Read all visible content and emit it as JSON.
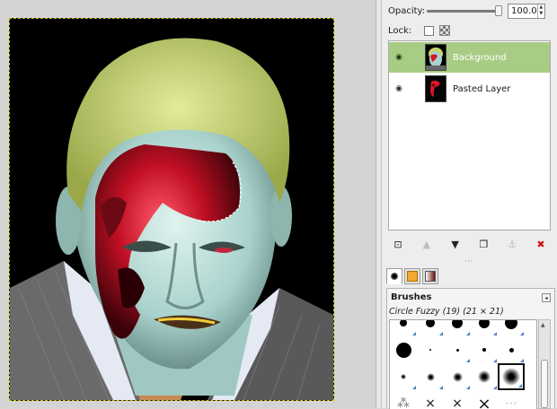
{
  "canvas": {
    "image_alt": "Photo-manipulated portrait of a man with zombie-like red facial wound"
  },
  "layers_dialog": {
    "opacity_label": "Opacity:",
    "opacity_value": "100.0",
    "opacity_fraction": 1.0,
    "lock_label": "Lock:",
    "layers": [
      {
        "name": "Background",
        "selected": true,
        "visible": true,
        "thumb_icon": "face-thumbnail"
      },
      {
        "name": "Pasted Layer",
        "selected": false,
        "visible": true,
        "thumb_icon": "red-fragment-thumbnail"
      }
    ],
    "buttons": [
      {
        "icon": "new-layer-icon",
        "glyph": "⊡",
        "enabled": true
      },
      {
        "icon": "raise-layer-icon",
        "glyph": "▲",
        "enabled": false
      },
      {
        "icon": "lower-layer-icon",
        "glyph": "▼",
        "enabled": true
      },
      {
        "icon": "duplicate-layer-icon",
        "glyph": "❐",
        "enabled": true
      },
      {
        "icon": "anchor-layer-icon",
        "glyph": "⚓",
        "enabled": false
      },
      {
        "icon": "delete-layer-icon",
        "glyph": "✖",
        "enabled": true
      }
    ],
    "resize_handle": "⋯"
  },
  "tabs": [
    {
      "icon": "brushes-tab-icon",
      "active": true
    },
    {
      "icon": "patterns-tab-icon",
      "active": false
    },
    {
      "icon": "gradients-tab-icon",
      "active": false
    }
  ],
  "brushes": {
    "title": "Brushes",
    "menu_glyph": "◂",
    "current_brush": "Circle Fuzzy (19) (21 × 21)"
  },
  "colors": {
    "selection": "#a9cc85",
    "hair": "#c8d46a",
    "wound": "#d8162a",
    "skin": "#b8dcd8"
  }
}
